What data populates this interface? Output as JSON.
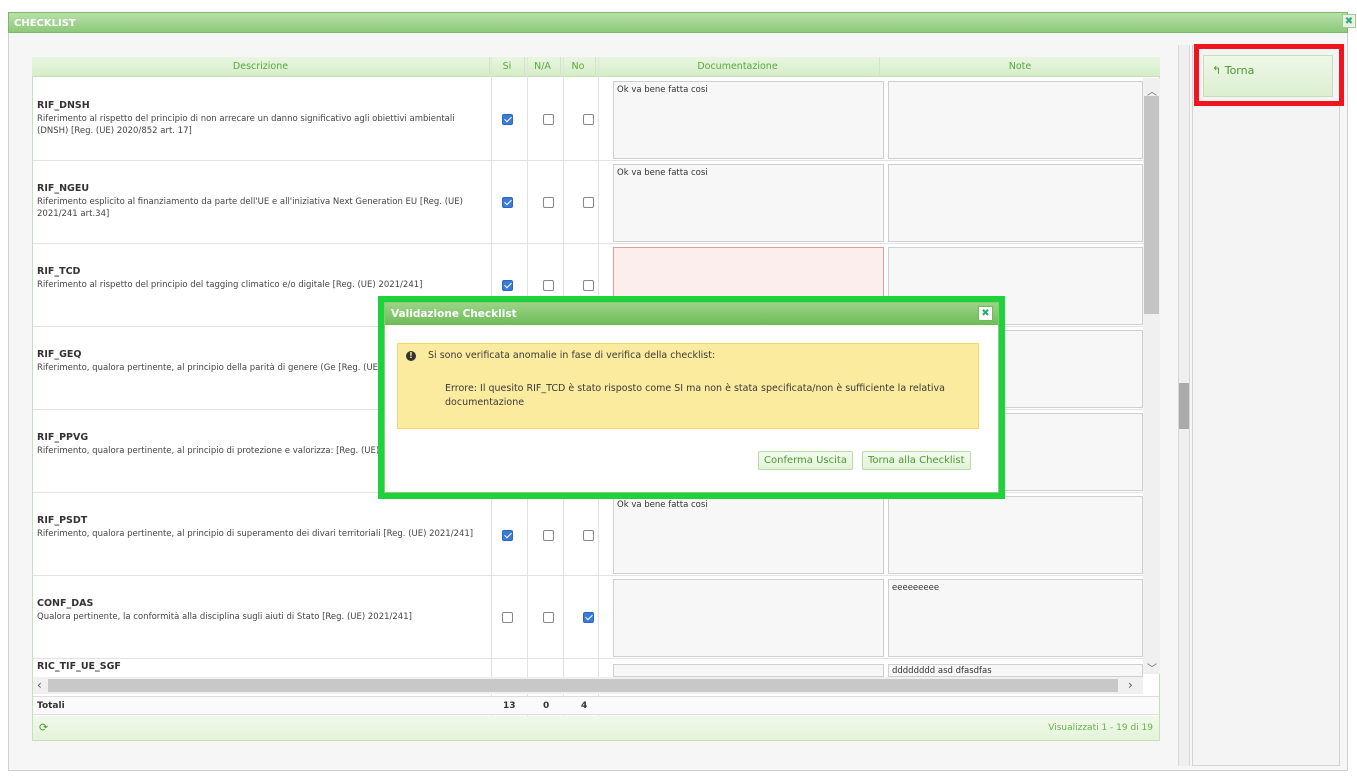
{
  "window": {
    "title": "CHECKLIST",
    "close_icon": "close-icon"
  },
  "table": {
    "columns": [
      "Descrizione",
      "Si",
      "N/A",
      "No",
      "Documentazione",
      "Note"
    ],
    "rows": [
      {
        "code": "RIF_DNSH",
        "text": "Riferimento al rispetto del principio di non arrecare un danno significativo agli obiettivi ambientali (DNSH) [Reg. (UE) 2020/852 art. 17]",
        "si": true,
        "na": false,
        "no": false,
        "doc": "Ok va bene fatta cosi",
        "note": ""
      },
      {
        "code": "RIF_NGEU",
        "text": "Riferimento esplicito al finanziamento da parte dell'UE e all'iniziativa Next Generation EU [Reg. (UE) 2021/241 art.34]",
        "si": true,
        "na": false,
        "no": false,
        "doc": "Ok va bene fatta cosi",
        "note": ""
      },
      {
        "code": "RIF_TCD",
        "text": "Riferimento al rispetto del principio del tagging climatico e/o digitale [Reg. (UE) 2021/241]",
        "si": true,
        "na": false,
        "no": false,
        "doc": "",
        "note": ""
      },
      {
        "code": "RIF_GEQ",
        "text": "Riferimento, qualora pertinente, al principio della parità di genere (Ge [Reg. (UE) 2021/241]",
        "si": null,
        "na": null,
        "no": null,
        "doc": "",
        "note": ""
      },
      {
        "code": "RIF_PPVG",
        "text": "Riferimento, qualora pertinente, al principio di protezione e valorizza: [Reg. (UE) 2021/241]",
        "si": null,
        "na": null,
        "no": null,
        "doc": "",
        "note": ""
      },
      {
        "code": "RIF_PSDT",
        "text": "Riferimento, qualora pertinente, al principio di superamento dei divari territoriali [Reg. (UE) 2021/241]",
        "si": true,
        "na": false,
        "no": false,
        "doc": "Ok va bene fatta cosi",
        "note": ""
      },
      {
        "code": "CONF_DAS",
        "text": "Qualora pertinente, la conformità alla disciplina sugli aiuti di Stato [Reg. (UE) 2021/241]",
        "si": false,
        "na": false,
        "no": true,
        "doc": "",
        "note": "eeeeeeeee"
      },
      {
        "code": "RIC_TIF_UE_SGF",
        "text": "",
        "si": null,
        "na": null,
        "no": null,
        "doc": "",
        "note": "dddddddd asd dfasdfas"
      }
    ],
    "totals": {
      "label": "Totali",
      "si": "13",
      "na": "0",
      "no": "4"
    },
    "footer": {
      "refresh_icon": "refresh-icon",
      "status": "Visualizzati 1 - 19 di 19"
    }
  },
  "sidebar": {
    "back_label": "Torna",
    "back_icon": "back-arrow-icon"
  },
  "dialog": {
    "title": "Validazione Checklist",
    "close_icon": "close-icon",
    "warning_icon": "exclamation-icon",
    "message": "Si sono verificata anomalie in fase di verifica della checklist:",
    "error": "Errore: Il quesito RIF_TCD è stato risposto come SI ma non è stata specificata/non è sufficiente la relativa documentazione",
    "confirm_label": "Conferma Uscita",
    "back_label": "Torna alla Checklist"
  },
  "colors": {
    "accent": "#6fbb58",
    "highlight_red": "#f0141e",
    "highlight_green": "#1fd13a",
    "warning_bg": "#fbeb9e"
  }
}
